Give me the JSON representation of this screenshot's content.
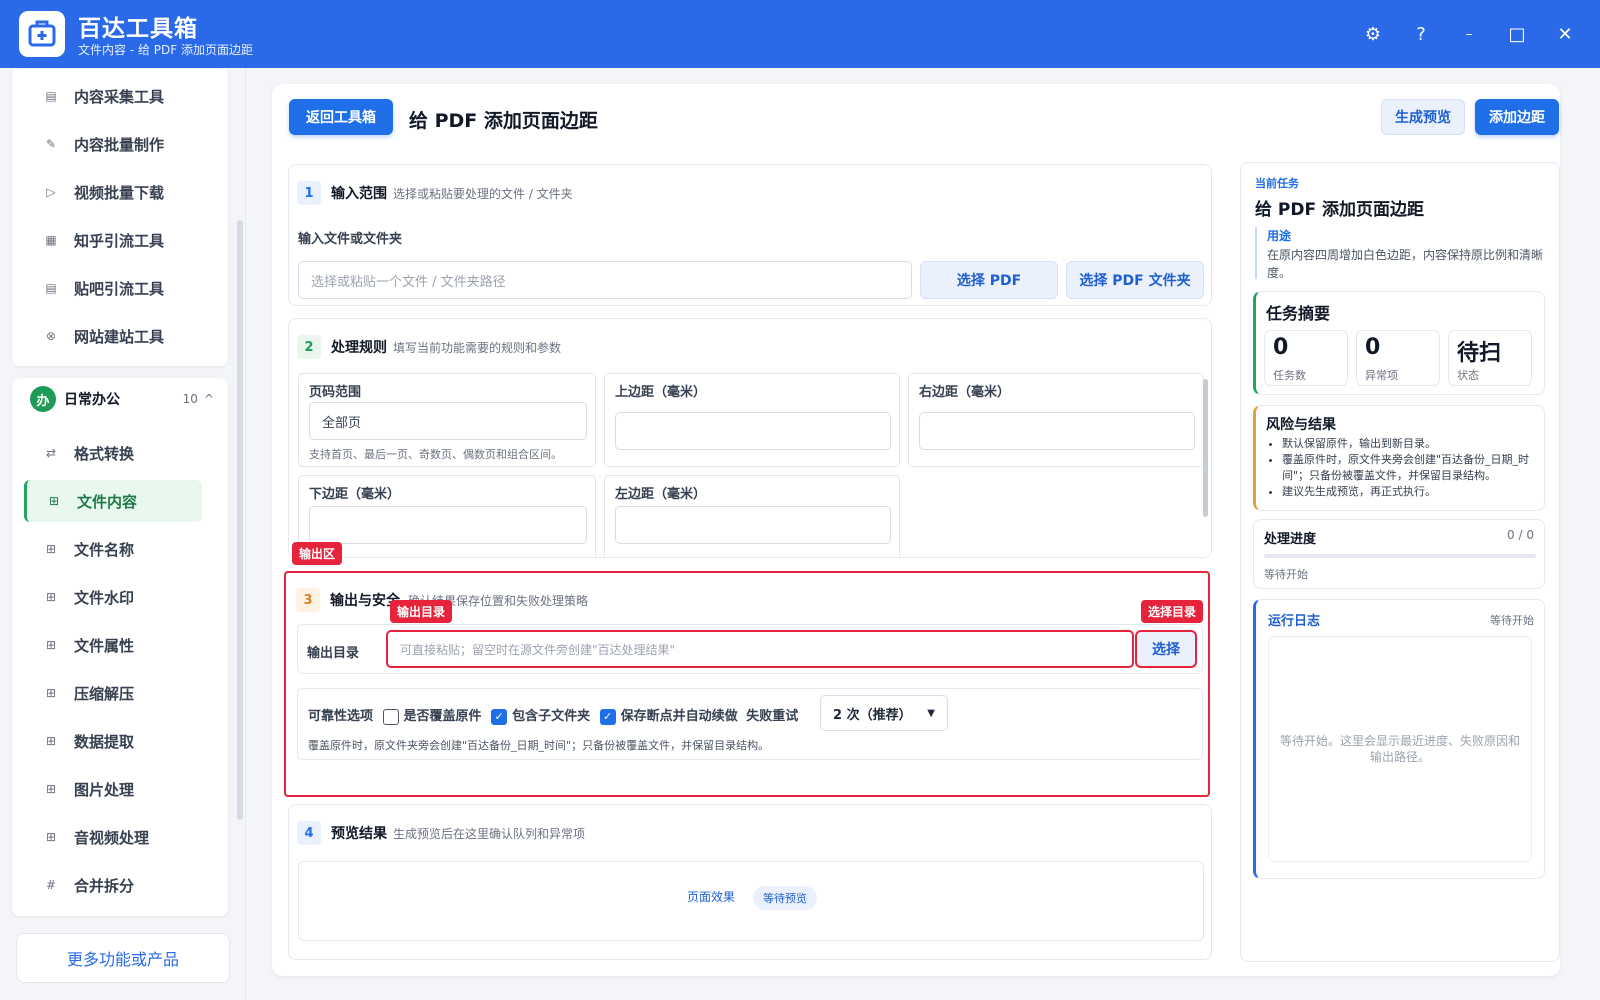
{
  "app": {
    "title": "百达工具箱",
    "subtitle": "文件内容 - 给 PDF 添加页面边距"
  },
  "window": {
    "settings": "⚙",
    "help": "?",
    "minimize": "–",
    "maximize": "□",
    "close": "✕"
  },
  "sidebar": {
    "top_items": [
      {
        "icon": "▤",
        "label": "内容采集工具"
      },
      {
        "icon": "✎",
        "label": "内容批量制作"
      },
      {
        "icon": "▷",
        "label": "视频批量下载"
      },
      {
        "icon": "▦",
        "label": "知乎引流工具"
      },
      {
        "icon": "▤",
        "label": "贴吧引流工具"
      },
      {
        "icon": "⊗",
        "label": "网站建站工具"
      }
    ],
    "group": {
      "badge": "办",
      "name": "日常办公",
      "count": "10",
      "toggle": "^"
    },
    "items": [
      {
        "icon": "⇄",
        "label": "格式转换"
      },
      {
        "icon": "⊞",
        "label": "文件内容"
      },
      {
        "icon": "⊞",
        "label": "文件名称"
      },
      {
        "icon": "⊞",
        "label": "文件水印"
      },
      {
        "icon": "⊞",
        "label": "文件属性"
      },
      {
        "icon": "⊞",
        "label": "压缩解压"
      },
      {
        "icon": "⊞",
        "label": "数据提取"
      },
      {
        "icon": "⊞",
        "label": "图片处理"
      },
      {
        "icon": "⊞",
        "label": "音视频处理"
      },
      {
        "icon": "#",
        "label": "合并拆分"
      }
    ],
    "more": "更多功能或产品"
  },
  "header": {
    "back": "返回工具箱",
    "title": "给 PDF 添加页面边距",
    "preview": "生成预览",
    "run": "添加边距"
  },
  "sec1": {
    "num": "1",
    "title": "输入范围",
    "desc": "选择或粘贴要处理的文件 / 文件夹",
    "label": "输入文件或文件夹",
    "placeholder": "选择或粘贴一个文件 / 文件夹路径",
    "btn_pdf": "选择 PDF",
    "btn_folder": "选择 PDF 文件夹"
  },
  "sec2": {
    "num": "2",
    "title": "处理规则",
    "desc": "填写当前功能需要的规则和参数",
    "page_range": {
      "label": "页码范围",
      "value": "全部页",
      "hint": "支持首页、最后一页、奇数页、偶数页和组合区间。"
    },
    "top": "上边距（毫米）",
    "right": "右边距（毫米）",
    "bottom": "下边距（毫米）",
    "left": "左边距（毫米）"
  },
  "annotations": {
    "output_zone": "输出区",
    "output_dir": "输出目录",
    "choose_dir": "选择目录"
  },
  "sec3": {
    "num": "3",
    "title": "输出与安全",
    "desc": "确认结果保存位置和失败处理策略",
    "dir_label": "输出目录",
    "dir_placeholder": "可直接粘贴；留空时在源文件旁创建\"百达处理结果\"",
    "choose": "选择",
    "reliability_label": "可靠性选项",
    "overwrite": "是否覆盖原件",
    "subfolders": "包含子文件夹",
    "resume": "保存断点并自动续做",
    "retry_label": "失败重试",
    "retry_value": "2 次（推荐）",
    "note": "覆盖原件时，原文件夹旁会创建\"百达备份_日期_时间\"；只备份被覆盖文件，并保留目录结构。"
  },
  "sec4": {
    "num": "4",
    "title": "预览结果",
    "desc": "生成预览后在这里确认队列和异常项",
    "effect": "页面效果",
    "status": "等待预览"
  },
  "right": {
    "tag": "当前任务",
    "title": "给 PDF 添加页面边距",
    "usage_label": "用途",
    "usage": "在原内容四周增加白色边距，内容保持原比例和清晰度。",
    "summary_title": "任务摘要",
    "stats": [
      {
        "value": "0",
        "key": "任务数"
      },
      {
        "value": "0",
        "key": "异常项"
      },
      {
        "value": "待扫",
        "key": "状态"
      }
    ],
    "risk_title": "风险与结果",
    "risks": [
      "默认保留原件，输出到新目录。",
      "覆盖原件时，原文件夹旁会创建\"百达备份_日期_时间\"；只备份被覆盖文件，并保留目录结构。",
      "建议先生成预览，再正式执行。"
    ],
    "progress_title": "处理进度",
    "progress_count": "0 / 0",
    "progress_fraction": 0,
    "progress_status": "等待开始",
    "log_title": "运行日志",
    "log_status": "等待开始",
    "log_body": "等待开始。这里会显示最近进度、失败原因和输出路径。"
  },
  "colors": {
    "accent": "#2a6ae8",
    "primary": "#1f6fe8",
    "active": "#25a260",
    "annotation": "#e5243b"
  }
}
